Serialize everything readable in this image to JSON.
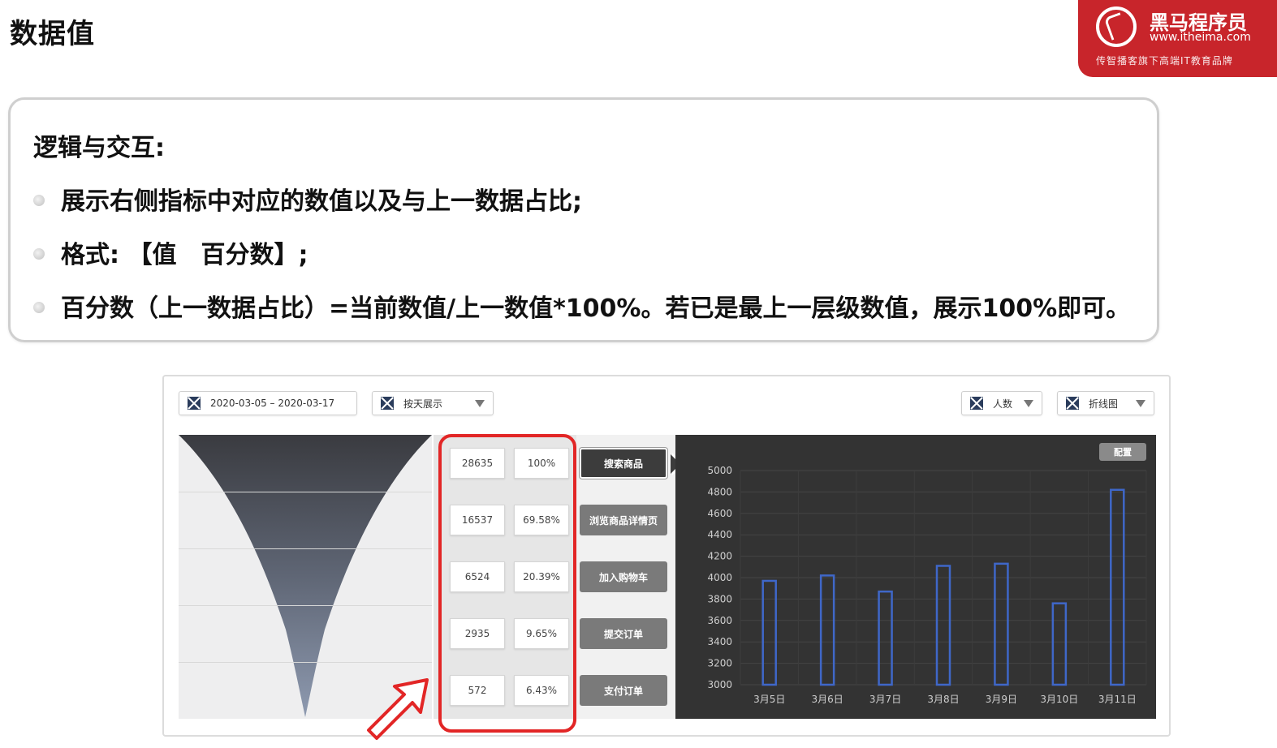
{
  "slide": {
    "title": "数据值",
    "brand": {
      "name": "黑马程序员",
      "url": "www.itheima.com",
      "slogan": "传智播客旗下高端IT教育品牌",
      "color": "#c8252b"
    }
  },
  "rules": {
    "heading": "逻辑与交互:",
    "items": [
      "展示右侧指标中对应的数值以及与上一数据占比;",
      "格式: 【值　百分数】;",
      "百分数（上一数据占比）=当前数值/上一数值*100%。若已是最上一层级数值，展示100%即可。"
    ]
  },
  "mockup": {
    "date_range": "2020-03-05 – 2020-03-17",
    "view_mode": "按天展示",
    "metric": "人数",
    "chart_kind": "折线图",
    "config_label": "配置",
    "stages": [
      {
        "label": "搜索商品",
        "value": "28635",
        "percent": "100%",
        "active": true
      },
      {
        "label": "浏览商品详情页",
        "value": "16537",
        "percent": "69.58%",
        "active": false
      },
      {
        "label": "加入购物车",
        "value": "6524",
        "percent": "20.39%",
        "active": false
      },
      {
        "label": "提交订单",
        "value": "2935",
        "percent": "9.65%",
        "active": false
      },
      {
        "label": "支付订单",
        "value": "572",
        "percent": "6.43%",
        "active": false
      }
    ],
    "highlight_color": "#e22626"
  },
  "chart_data": {
    "type": "bar",
    "categories": [
      "3月5日",
      "3月6日",
      "3月7日",
      "3月8日",
      "3月9日",
      "3月10日",
      "3月11日"
    ],
    "values": [
      3970,
      4020,
      3870,
      4110,
      4130,
      3760,
      4820
    ],
    "ylim": [
      3000,
      5000
    ],
    "yticks": [
      3000,
      3200,
      3400,
      3600,
      3800,
      4000,
      4200,
      4400,
      4600,
      4800,
      5000
    ],
    "grid": true,
    "bar_color": "#3f67c8",
    "background": "#333333"
  }
}
